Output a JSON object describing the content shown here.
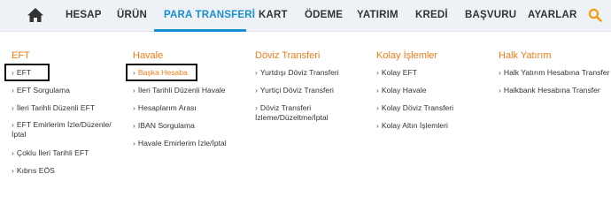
{
  "nav": {
    "home_icon": "home-icon",
    "items": [
      {
        "label": "HESAP"
      },
      {
        "label": "ÜRÜN"
      },
      {
        "label": "PARA TRANSFERİ"
      },
      {
        "label": "KART"
      },
      {
        "label": "ÖDEME"
      },
      {
        "label": "YATIRIM"
      },
      {
        "label": "KREDİ"
      },
      {
        "label": "BAŞVURU"
      },
      {
        "label": "AYARLAR"
      }
    ],
    "active_index": 2,
    "search_icon": "search-icon",
    "accent_color": "#1a8fd0",
    "search_icon_color": "#f39c12"
  },
  "menu": {
    "title_color": "#f07d19",
    "columns": [
      {
        "title": "EFT",
        "links": [
          "EFT",
          "EFT Sorgulama",
          "İleri Tarihli Düzenli EFT",
          "EFT Emirlerim İzle/Düzenle/ İptal",
          "Çoklu İleri Tarihli EFT",
          "Kıbrıs EÖS"
        ]
      },
      {
        "title": "Havale",
        "links": [
          "Başka Hesaba",
          "İleri Tarihli Düzenli Havale",
          "Hesaplarım Arası",
          "IBAN Sorgulama",
          "Havale Emirlerim İzle/İptal"
        ]
      },
      {
        "title": "Döviz Transferi",
        "links": [
          "Yurtdışı Döviz Transferi",
          "Yurtiçi Döviz Transferi",
          "Döviz Transferi İzleme/Düzeltme/İptal"
        ]
      },
      {
        "title": "Kolay İşlemler",
        "links": [
          "Kolay EFT",
          "Kolay Havale",
          "Kolay Döviz Transferi",
          "Kolay Altın İşlemleri"
        ]
      },
      {
        "title": "Halk Yatırım",
        "links": [
          "Halk Yatırım Hesabına Transfer",
          "Halkbank Hesabına Transfer"
        ]
      }
    ]
  }
}
